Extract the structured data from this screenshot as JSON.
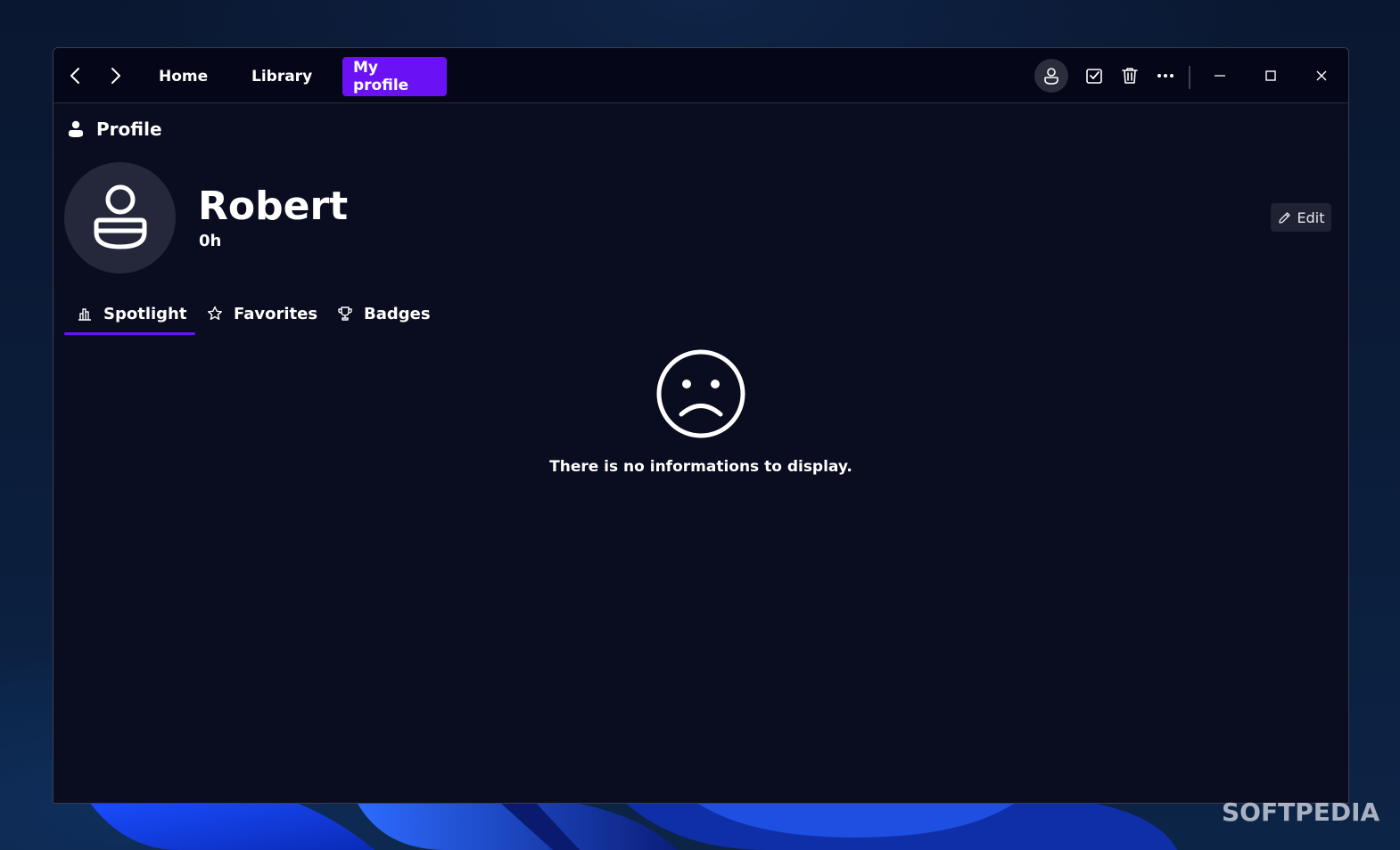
{
  "nav": {
    "tabs": [
      {
        "label": "Home",
        "active": false
      },
      {
        "label": "Library",
        "active": false
      },
      {
        "label": "My profile",
        "active": true
      }
    ],
    "accent_color": "#6a12f5"
  },
  "titlebar_icons": [
    "user-avatar-icon",
    "checkbox-icon",
    "trash-icon",
    "more-icon",
    "minimize-icon",
    "maximize-icon",
    "close-icon"
  ],
  "section": {
    "title": "Profile"
  },
  "profile": {
    "name": "Robert",
    "play_time": "0h",
    "edit_label": "Edit"
  },
  "tabs": [
    {
      "label": "Spotlight",
      "icon": "chart-icon",
      "active": true
    },
    {
      "label": "Favorites",
      "icon": "star-icon",
      "active": false
    },
    {
      "label": "Badges",
      "icon": "trophy-icon",
      "active": false
    }
  ],
  "empty_state": {
    "icon": "sad-face-icon",
    "message": "There is no informations to display."
  },
  "watermark": "SOFTPEDIA"
}
